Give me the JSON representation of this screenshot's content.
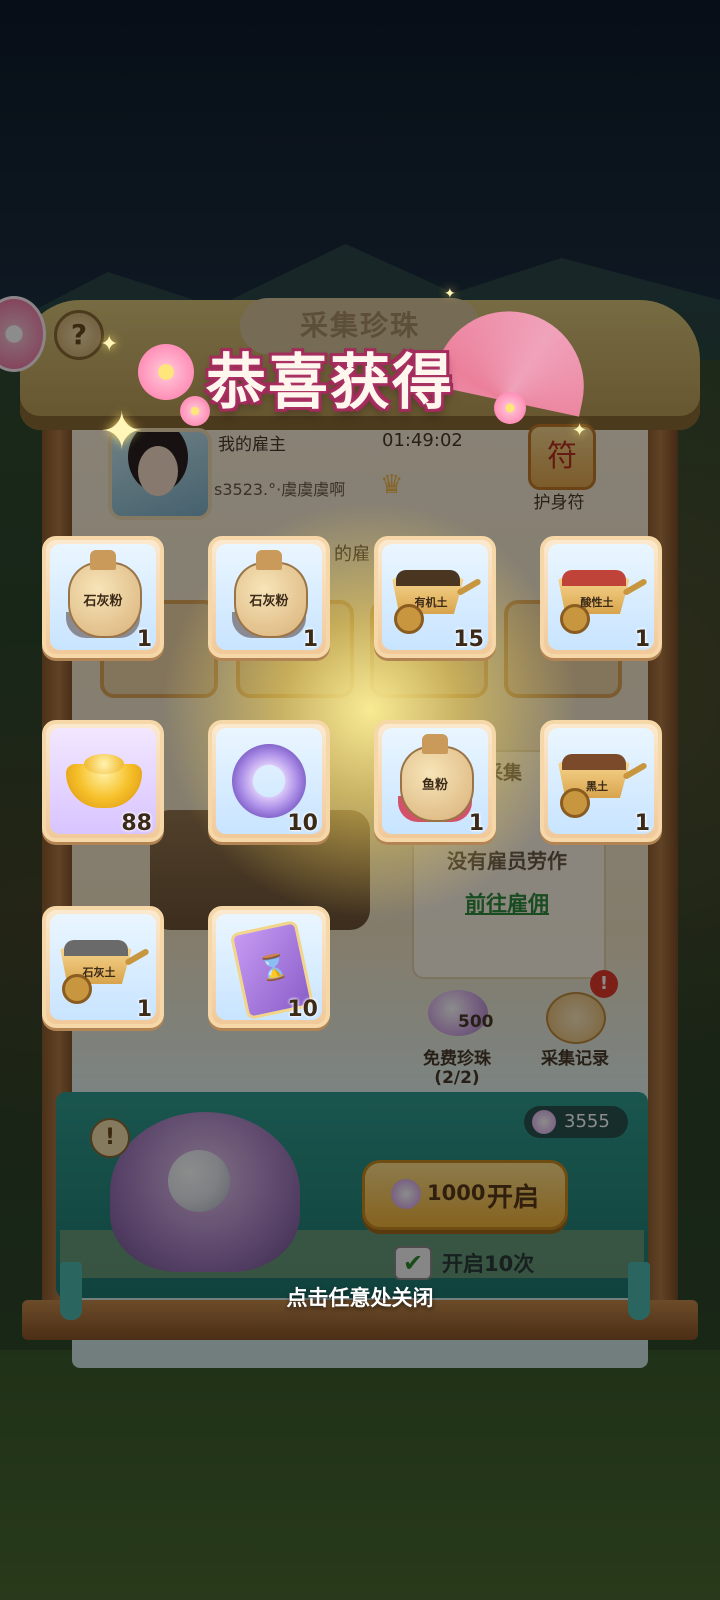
{
  "banner": {
    "title": "恭喜获得"
  },
  "panel": {
    "title": "采集珍珠"
  },
  "employer": {
    "label": "我的雇主",
    "timer": "01:49:02",
    "name": "s3523.°·虞虞虞啊"
  },
  "amulet": {
    "label": "护身符"
  },
  "behind": {
    "partial_text": "的雇",
    "gather_partial": "采集",
    "no_worker": "没有雇员劳作",
    "hire_link": "前往雇佣"
  },
  "free_pearl": {
    "count": "500",
    "label": "免费珍珠",
    "sub": "(2/2)"
  },
  "record": {
    "label": "采集记录",
    "badge": "!"
  },
  "drawer": {
    "balance": "3555",
    "open_cost": "1000",
    "open_label": "开启",
    "open10_label": "开启10次",
    "warn": "!"
  },
  "rewards": [
    {
      "type": "sack",
      "label": "石灰粉",
      "count": "1",
      "base": "#8a8a92"
    },
    {
      "type": "sack",
      "label": "石灰粉",
      "count": "1",
      "base": "#8a8a92"
    },
    {
      "type": "barrow",
      "label": "有机土",
      "count": "15",
      "soil": "#4a3520"
    },
    {
      "type": "barrow",
      "label": "酸性土",
      "count": "1",
      "soil": "#c0433a"
    },
    {
      "type": "ingot",
      "label": "",
      "count": "88"
    },
    {
      "type": "ring",
      "label": "",
      "count": "10"
    },
    {
      "type": "sack",
      "label": "鱼粉",
      "count": "1",
      "base": "#d2526a"
    },
    {
      "type": "barrow",
      "label": "黑土",
      "count": "1",
      "soil": "#7a4a2a"
    },
    {
      "type": "barrow",
      "label": "石灰土",
      "count": "1",
      "soil": "#6a6a6a"
    },
    {
      "type": "scroll",
      "label": "",
      "count": "10"
    }
  ],
  "close_hint": "点击任意处关闭",
  "icons": {
    "help": "question-icon",
    "crown": "crown-icon",
    "hourglass": "hourglass-icon",
    "check": "check-icon"
  },
  "colors": {
    "banner_outline": "#a02a5a",
    "hire_link": "#2e8a3c",
    "open_button": "#f3b43a"
  }
}
